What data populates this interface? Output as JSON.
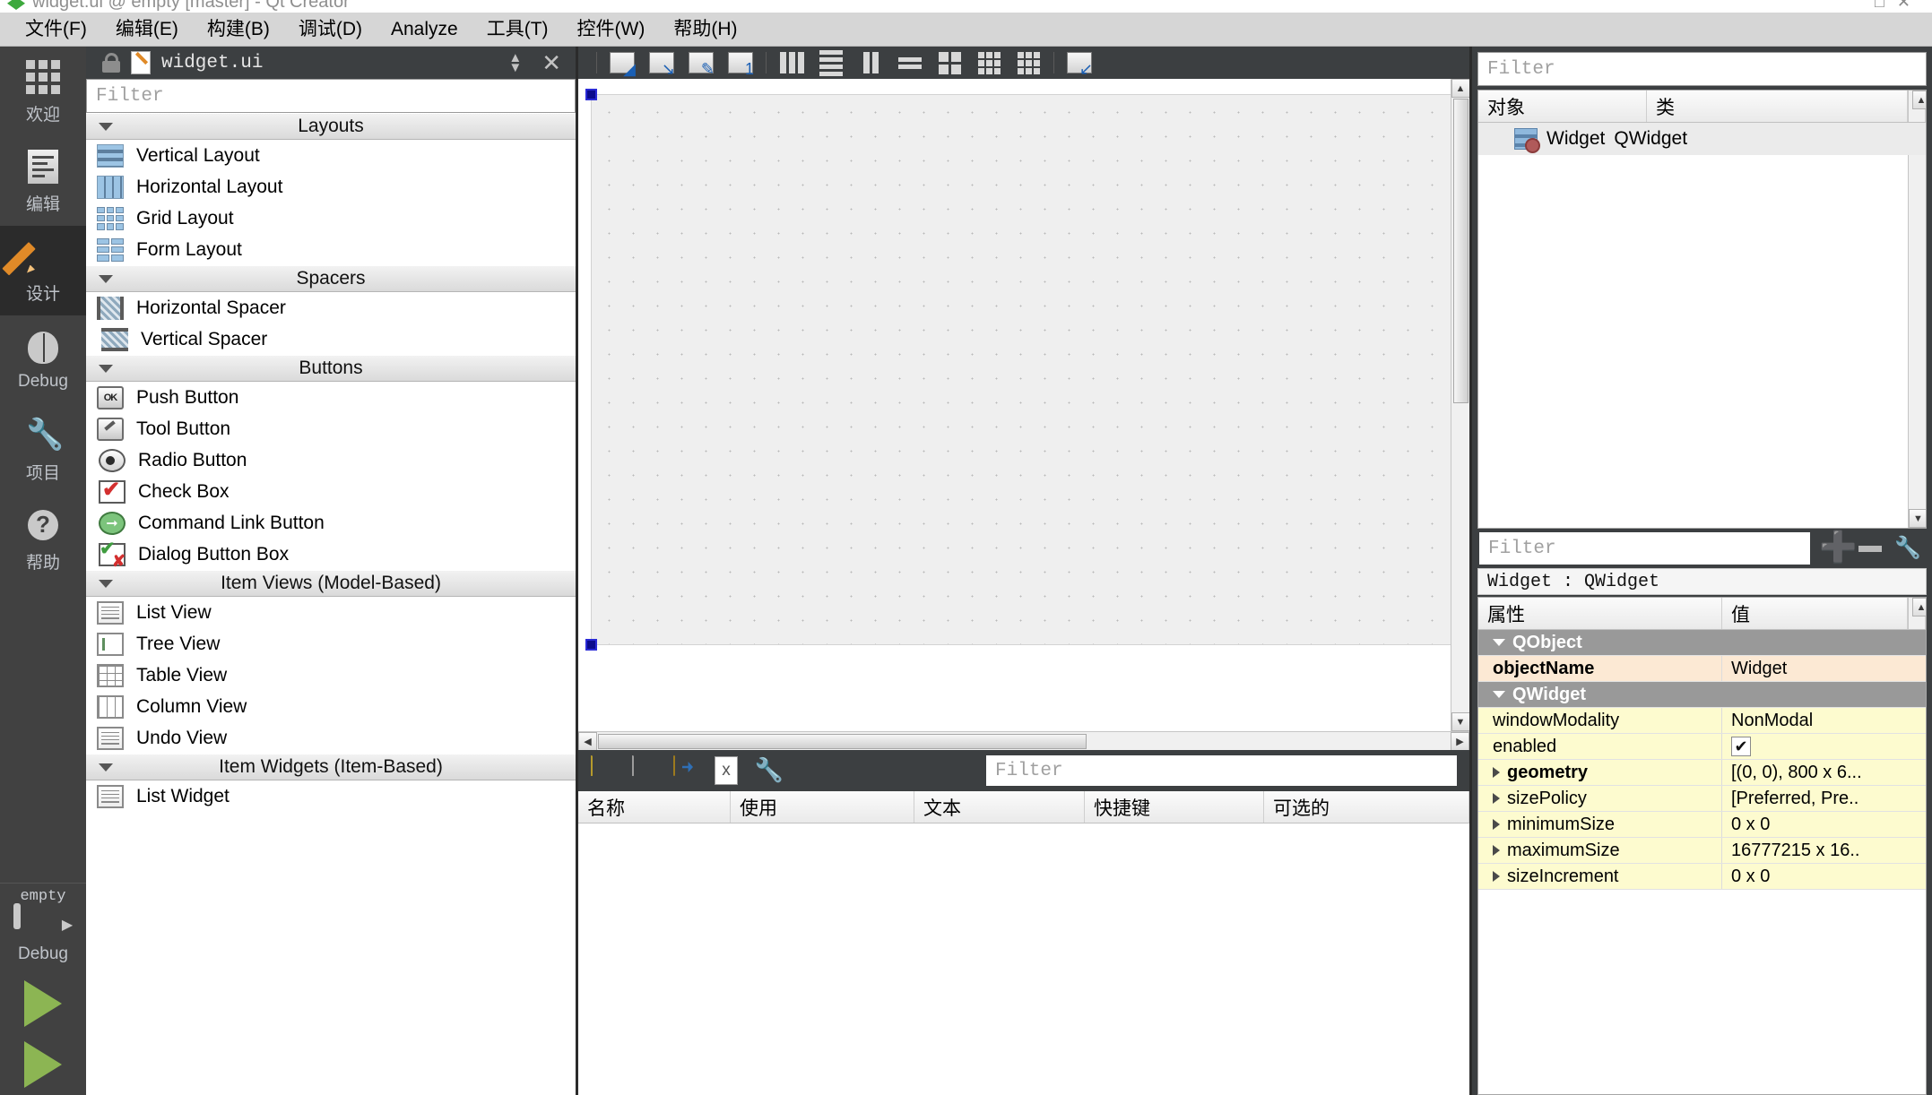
{
  "window": {
    "title": "widget.ui @ empty [master] - Qt Creator"
  },
  "menubar": [
    {
      "label": "文件(F)",
      "mnemonic": "F"
    },
    {
      "label": "编辑(E)",
      "mnemonic": "E"
    },
    {
      "label": "构建(B)",
      "mnemonic": "B"
    },
    {
      "label": "调试(D)",
      "mnemonic": "D"
    },
    {
      "label": "Analyze",
      "mnemonic": "A"
    },
    {
      "label": "工具(T)",
      "mnemonic": "T"
    },
    {
      "label": "控件(W)",
      "mnemonic": "W"
    },
    {
      "label": "帮助(H)",
      "mnemonic": "H"
    }
  ],
  "modes": [
    {
      "label": "欢迎",
      "icon": "grid-icon",
      "active": false
    },
    {
      "label": "编辑",
      "icon": "document-icon",
      "active": false
    },
    {
      "label": "设计",
      "icon": "pencil-icon",
      "active": true
    },
    {
      "label": "Debug",
      "icon": "bug-icon",
      "active": false
    },
    {
      "label": "项目",
      "icon": "wrench-icon",
      "active": false
    },
    {
      "label": "帮助",
      "icon": "question-icon",
      "active": false
    }
  ],
  "kit_selector": {
    "project": "empty",
    "build_config": "Debug",
    "run_label": "run",
    "debug_label": "debug"
  },
  "widget_box": {
    "title": "widget.ui",
    "filter_placeholder": "Filter",
    "categories": [
      {
        "name": "Layouts",
        "items": [
          {
            "label": "Vertical Layout",
            "icon": "vertical-layout-icon"
          },
          {
            "label": "Horizontal Layout",
            "icon": "horizontal-layout-icon"
          },
          {
            "label": "Grid Layout",
            "icon": "grid-layout-icon"
          },
          {
            "label": "Form Layout",
            "icon": "form-layout-icon"
          }
        ]
      },
      {
        "name": "Spacers",
        "items": [
          {
            "label": "Horizontal Spacer",
            "icon": "horizontal-spacer-icon"
          },
          {
            "label": "Vertical Spacer",
            "icon": "vertical-spacer-icon"
          }
        ]
      },
      {
        "name": "Buttons",
        "items": [
          {
            "label": "Push Button",
            "icon": "push-button-icon"
          },
          {
            "label": "Tool Button",
            "icon": "tool-button-icon"
          },
          {
            "label": "Radio Button",
            "icon": "radio-button-icon"
          },
          {
            "label": "Check Box",
            "icon": "check-box-icon"
          },
          {
            "label": "Command Link Button",
            "icon": "command-link-icon"
          },
          {
            "label": "Dialog Button Box",
            "icon": "dialog-button-box-icon"
          }
        ]
      },
      {
        "name": "Item Views (Model-Based)",
        "items": [
          {
            "label": "List View",
            "icon": "list-view-icon"
          },
          {
            "label": "Tree View",
            "icon": "tree-view-icon"
          },
          {
            "label": "Table View",
            "icon": "table-view-icon"
          },
          {
            "label": "Column View",
            "icon": "column-view-icon"
          },
          {
            "label": "Undo View",
            "icon": "undo-view-icon"
          }
        ]
      },
      {
        "name": "Item Widgets (Item-Based)",
        "items": [
          {
            "label": "List Widget",
            "icon": "list-widget-icon"
          }
        ]
      }
    ]
  },
  "designer_toolbar": [
    {
      "name": "edit-widgets-icon"
    },
    {
      "name": "edit-signals-slots-icon"
    },
    {
      "name": "edit-buddies-icon"
    },
    {
      "name": "edit-tab-order-icon"
    },
    {
      "name": "layout-horizontally-icon"
    },
    {
      "name": "layout-vertically-icon"
    },
    {
      "name": "layout-splitter-horizontal-icon"
    },
    {
      "name": "layout-splitter-vertical-icon"
    },
    {
      "name": "layout-form-icon"
    },
    {
      "name": "layout-grid-icon"
    },
    {
      "name": "break-layout-icon"
    },
    {
      "name": "adjust-size-icon"
    }
  ],
  "action_editor": {
    "filter_placeholder": "Filter",
    "toolbar": [
      {
        "name": "new-action-icon"
      },
      {
        "name": "copy-action-icon"
      },
      {
        "name": "open-action-icon"
      },
      {
        "name": "delete-action-icon"
      },
      {
        "name": "configure-icon"
      }
    ],
    "columns": [
      "名称",
      "使用",
      "文本",
      "快捷键",
      "可选的"
    ],
    "rows": []
  },
  "object_inspector": {
    "filter_placeholder": "Filter",
    "columns": [
      "对象",
      "类"
    ],
    "rows": [
      {
        "object": "Widget",
        "class": "QWidget",
        "icon": "widget-icon"
      }
    ]
  },
  "property_editor": {
    "filter_placeholder": "Filter",
    "selected_object": "Widget : QWidget",
    "columns": [
      "属性",
      "值"
    ],
    "toolbar": [
      {
        "name": "add-property-icon"
      },
      {
        "name": "remove-property-icon"
      },
      {
        "name": "configure-property-icon"
      }
    ],
    "rows": [
      {
        "kind": "group",
        "name": "QObject",
        "value": ""
      },
      {
        "kind": "prop",
        "style": "peach",
        "bold": true,
        "name": "objectName",
        "value": "Widget",
        "expandable": false
      },
      {
        "kind": "group",
        "name": "QWidget",
        "value": ""
      },
      {
        "kind": "prop",
        "style": "cream",
        "bold": false,
        "name": "windowModality",
        "value": "NonModal",
        "expandable": false
      },
      {
        "kind": "prop",
        "style": "cream",
        "bold": false,
        "name": "enabled",
        "value": "",
        "checkbox": true,
        "checked": true,
        "expandable": false
      },
      {
        "kind": "prop",
        "style": "cream",
        "bold": true,
        "name": "geometry",
        "value": "[(0, 0), 800 x 6...",
        "expandable": true
      },
      {
        "kind": "prop",
        "style": "cream",
        "bold": false,
        "name": "sizePolicy",
        "value": "[Preferred, Pre..",
        "expandable": true
      },
      {
        "kind": "prop",
        "style": "cream",
        "bold": false,
        "name": "minimumSize",
        "value": "0 x 0",
        "expandable": true
      },
      {
        "kind": "prop",
        "style": "cream",
        "bold": false,
        "name": "maximumSize",
        "value": "16777215 x 16..",
        "expandable": true
      },
      {
        "kind": "prop",
        "style": "cream",
        "bold": false,
        "name": "sizeIncrement",
        "value": "0 x 0",
        "expandable": true
      }
    ]
  },
  "colors": {
    "chrome": "#3c3f41",
    "menubar": "#d6d6d6",
    "accent_orange": "#e08a28",
    "group_row": "#999999",
    "peach_row": "#fce9d4",
    "cream_row": "#fdfbcf",
    "run_green": "#8cb553",
    "selection_handle": "#0b0b8c"
  }
}
